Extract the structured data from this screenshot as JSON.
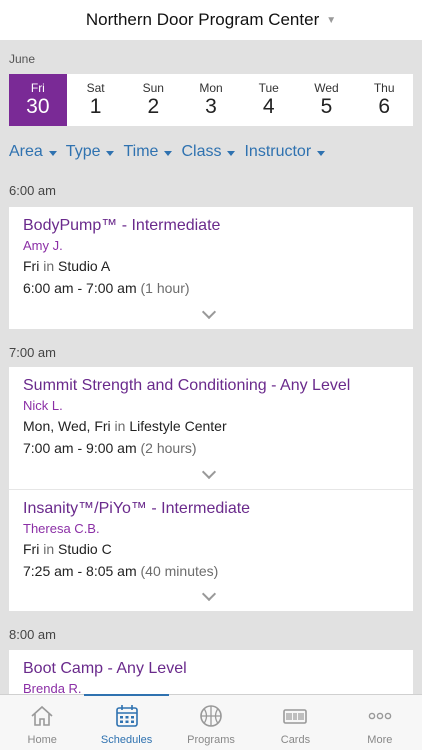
{
  "header": {
    "title": "Northern Door Program Center"
  },
  "calendar": {
    "month": "June",
    "days": [
      {
        "name": "Fri",
        "num": "30",
        "selected": true
      },
      {
        "name": "Sat",
        "num": "1"
      },
      {
        "name": "Sun",
        "num": "2"
      },
      {
        "name": "Mon",
        "num": "3"
      },
      {
        "name": "Tue",
        "num": "4"
      },
      {
        "name": "Wed",
        "num": "5"
      },
      {
        "name": "Thu",
        "num": "6"
      }
    ]
  },
  "filters": [
    "Area",
    "Type",
    "Time",
    "Class",
    "Instructor"
  ],
  "groups": [
    {
      "time": "6:00 am",
      "sessions": [
        {
          "title": "BodyPump™ - Intermediate",
          "instructor": "Amy J.",
          "days": "Fri",
          "in": "in",
          "location": "Studio A",
          "time": "6:00 am - 7:00 am",
          "duration": "(1 hour)"
        }
      ]
    },
    {
      "time": "7:00 am",
      "sessions": [
        {
          "title": "Summit Strength and Conditioning - Any Level",
          "instructor": "Nick L.",
          "days": "Mon, Wed, Fri",
          "in": "in",
          "location": "Lifestyle Center",
          "time": "7:00 am - 9:00 am",
          "duration": "(2 hours)"
        },
        {
          "title": "Insanity™/PiYo™ - Intermediate",
          "instructor": "Theresa C.B.",
          "days": "Fri",
          "in": "in",
          "location": "Studio C",
          "time": "7:25 am - 8:05 am",
          "duration": "(40 minutes)"
        }
      ]
    },
    {
      "time": "8:00 am",
      "sessions": [
        {
          "title": "Boot Camp - Any Level",
          "instructor": "Brenda R."
        }
      ]
    }
  ],
  "tabs": [
    {
      "label": "Home",
      "icon": "home-icon"
    },
    {
      "label": "Schedules",
      "icon": "calendar-icon",
      "active": true
    },
    {
      "label": "Programs",
      "icon": "basketball-icon"
    },
    {
      "label": "Cards",
      "icon": "card-icon"
    },
    {
      "label": "More",
      "icon": "more-icon"
    }
  ],
  "colors": {
    "accent": "#7a2a96",
    "link": "#2f72b0",
    "background": "#e1e1e1"
  }
}
